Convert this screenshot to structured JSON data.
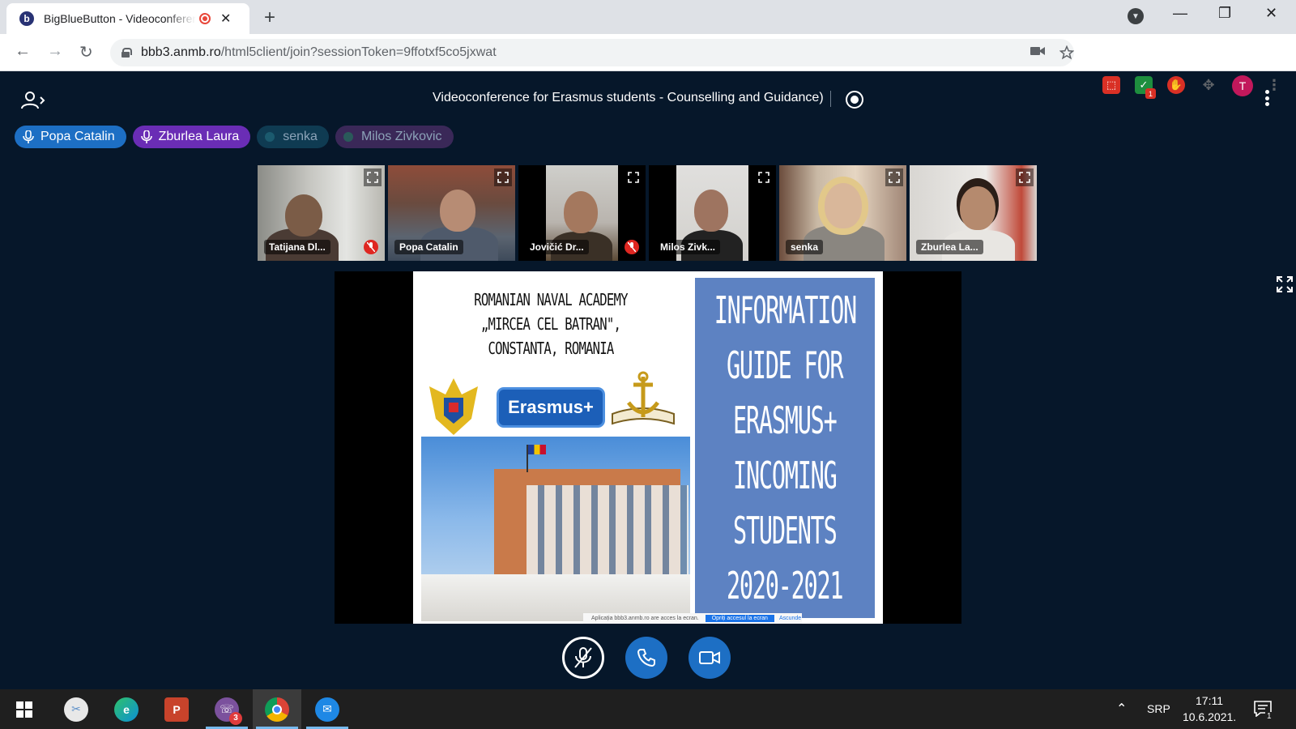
{
  "browser": {
    "tab_title": "BigBlueButton - Videoconference",
    "tab_favicon": "b",
    "new_tab_icon": "+",
    "close_tab_icon": "✕",
    "url_host": "bbb3.anmb.ro",
    "url_path": "/html5client/join?sessionToken=9ffotxf5co5jxwat",
    "profile_initial": "T",
    "extension_badge": "1",
    "window": {
      "minimize": "—",
      "restore": "❐",
      "close": "✕"
    }
  },
  "meeting": {
    "title": "Videoconference for Erasmus students - Counselling and Guidance)",
    "talkers": [
      {
        "name": "Popa Catalin",
        "state": "active",
        "color": "blue"
      },
      {
        "name": "Zburlea Laura",
        "state": "active",
        "color": "purple"
      },
      {
        "name": "senka",
        "state": "idle",
        "color": "teal"
      },
      {
        "name": "Milos Zivkovic",
        "state": "idle",
        "color": "purple"
      }
    ],
    "videos": [
      {
        "label": "Tatijana Dl...",
        "muted": true,
        "speaking": false
      },
      {
        "label": "Popa Catalin",
        "muted": false,
        "speaking": true
      },
      {
        "label": "Jovičić Dr...",
        "muted": true,
        "speaking": false
      },
      {
        "label": "Milos Zivk...",
        "muted": false,
        "speaking": false
      },
      {
        "label": "senka",
        "muted": false,
        "speaking": false
      },
      {
        "label": "Zburlea La...",
        "muted": false,
        "speaking": true
      }
    ]
  },
  "slide": {
    "left_title": [
      "ROMANIAN NAVAL ACADEMY",
      "„MIRCEA CEL BATRAN\",",
      "CONSTANTA, ROMANIA"
    ],
    "erasmus_logo": "Erasmus+",
    "right_title": [
      "INFORMATION",
      "GUIDE FOR",
      "ERASMUS+",
      "INCOMING",
      "STUDENTS",
      "2020-2021"
    ],
    "share_notice": "Aplicația bbb3.anmb.ro are acces la ecran.",
    "share_stop": "Opriți accesul la ecran",
    "share_hide": "Ascunde"
  },
  "taskbar": {
    "apps": [
      {
        "name": "snip-sketch",
        "color": "#E8E8E8"
      },
      {
        "name": "edge",
        "color": "#0C8FD6"
      },
      {
        "name": "powerpoint",
        "color": "#C8432B",
        "label": "P"
      },
      {
        "name": "viber",
        "color": "#7B519D",
        "badge": "3"
      },
      {
        "name": "chrome",
        "color": "#DB4437",
        "active": true
      },
      {
        "name": "messenger",
        "color": "#1E88E5"
      }
    ],
    "language": "SRP",
    "time": "17:11",
    "date": "10.6.2021.",
    "notification_count": "1"
  },
  "colors": {
    "app_background": "#06172A",
    "accent_blue": "#1D6FC4",
    "muted_red": "#DF2721",
    "slide_panel": "#5D82C2"
  }
}
